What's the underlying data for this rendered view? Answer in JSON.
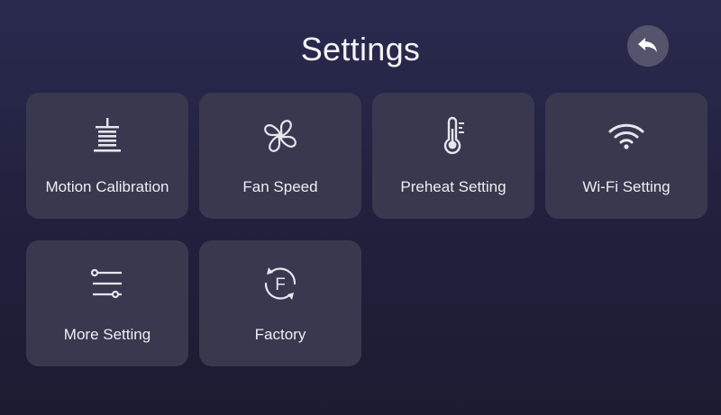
{
  "header": {
    "title": "Settings",
    "back_icon": "back-arrow-icon"
  },
  "colors": {
    "background": "#23223f",
    "tile": "#38384f",
    "back_button": "#54546c",
    "text": "#eeeef2"
  },
  "tiles": [
    {
      "label": "Motion Calibration",
      "icon": "motion-calibration-icon"
    },
    {
      "label": "Fan Speed",
      "icon": "fan-icon"
    },
    {
      "label": "Preheat Setting",
      "icon": "thermometer-icon"
    },
    {
      "label": "Wi-Fi Setting",
      "icon": "wifi-icon"
    },
    {
      "label": "More Setting",
      "icon": "sliders-icon"
    },
    {
      "label": "Factory",
      "icon": "factory-reset-icon"
    }
  ]
}
